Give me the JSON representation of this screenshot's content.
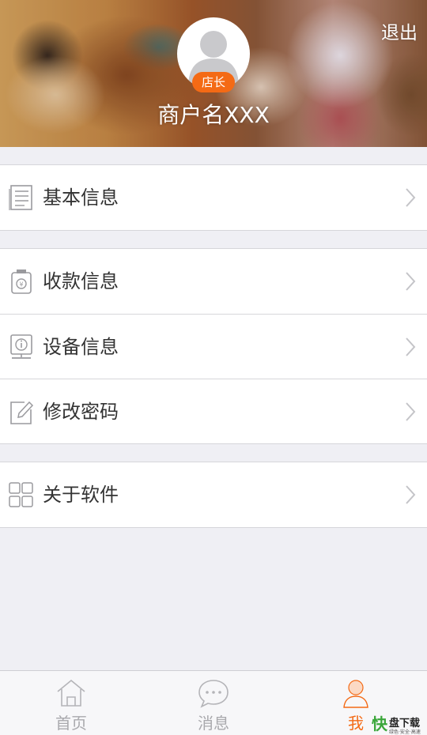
{
  "header": {
    "logout_label": "退出",
    "badge_label": "店长",
    "shop_name": "商户名XXX"
  },
  "menu_groups": [
    [
      {
        "label": "基本信息",
        "icon": "document-icon"
      }
    ],
    [
      {
        "label": "收款信息",
        "icon": "wallet-icon"
      },
      {
        "label": "设备信息",
        "icon": "device-info-icon"
      },
      {
        "label": "修改密码",
        "icon": "edit-icon"
      }
    ],
    [
      {
        "label": "关于软件",
        "icon": "grid-icon"
      }
    ]
  ],
  "tabbar": {
    "tabs": [
      {
        "label": "首页",
        "icon": "home-icon",
        "active": false
      },
      {
        "label": "消息",
        "icon": "message-icon",
        "active": false
      },
      {
        "label": "我",
        "icon": "user-icon",
        "active": true
      }
    ]
  },
  "watermark": {
    "brand_a": "快",
    "brand_b": "盘下载",
    "tagline": "绿色·安全·高速"
  },
  "colors": {
    "accent": "#f46a15",
    "background": "#efeff4",
    "inactive": "#a9a9ad"
  }
}
